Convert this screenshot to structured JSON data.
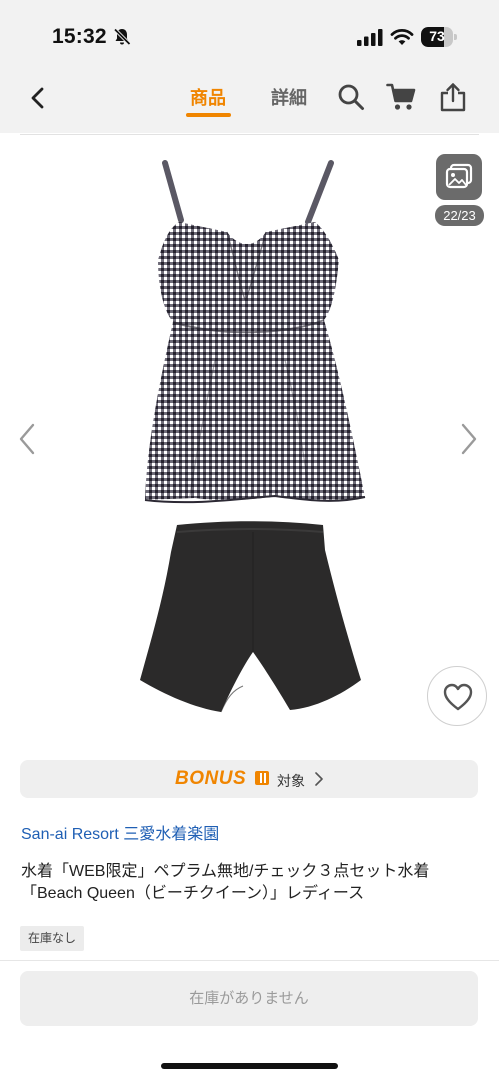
{
  "status_bar": {
    "time": "15:32",
    "battery": "73",
    "battery_level": 0.73
  },
  "nav": {
    "tabs": [
      {
        "label": "商品",
        "active": true
      },
      {
        "label": "詳細",
        "active": false
      }
    ],
    "icons": [
      "back-arrow-icon",
      "search-icon",
      "cart-icon",
      "share-icon"
    ],
    "accent_color": "#f08500"
  },
  "gallery": {
    "counter": "22/23",
    "current_index": 22,
    "total": 23
  },
  "bonus": {
    "logo": "BONUS",
    "label": "対象"
  },
  "product": {
    "brand": "San-ai Resort 三愛水着楽園",
    "title": "水着「WEB限定」ペプラム無地/チェック３点セット水着「Beach Queen（ビーチクイーン）」レディース",
    "stock_badge": "在庫なし",
    "cta_label": "在庫がありません"
  }
}
